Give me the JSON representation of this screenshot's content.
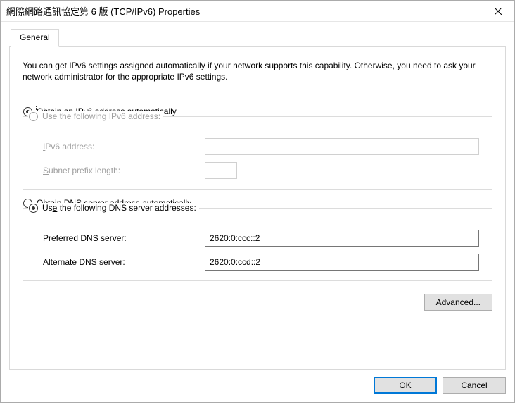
{
  "window": {
    "title": "網際網路通訊協定第 6 版 (TCP/IPv6) Properties"
  },
  "tabs": {
    "general": "General"
  },
  "intro": "You can get IPv6 settings assigned automatically if your network supports this capability. Otherwise, you need to ask your network administrator for the appropriate IPv6 settings.",
  "ip": {
    "auto_label_pre": "O",
    "auto_label_post": "btain an IPv6 address automatically",
    "manual_label_pre": "U",
    "manual_label_post": "se the following IPv6 address:",
    "addr_label_pre": "I",
    "addr_label_post": "Pv6 address:",
    "prefix_label_pre": "S",
    "prefix_label_post": "ubnet prefix length:",
    "addr_value": "",
    "prefix_value": ""
  },
  "dns": {
    "auto_label_pre": "O",
    "auto_label_post": "btain DNS server address automatically",
    "manual_label_pre": "Us",
    "manual_label_u": "e",
    "manual_label_post": " the following DNS server addresses:",
    "pref_label_pre": "P",
    "pref_label_post": "referred DNS server:",
    "alt_label_pre": "A",
    "alt_label_post": "lternate DNS server:",
    "pref_value": "2620:0:ccc::2",
    "alt_value": "2620:0:ccd::2"
  },
  "buttons": {
    "advanced_pre": "Ad",
    "advanced_u": "v",
    "advanced_post": "anced...",
    "ok": "OK",
    "cancel": "Cancel"
  }
}
